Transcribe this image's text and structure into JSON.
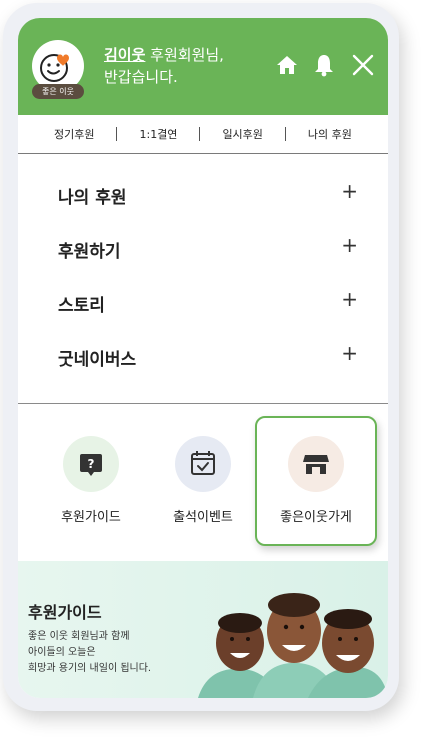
{
  "header": {
    "avatar_badge": "좋은 이웃",
    "user_name": "김이웃",
    "greeting_suffix": " 후원회원님,",
    "greeting_line2": "반갑습니다."
  },
  "tabs": [
    "정기후원",
    "1:1결연",
    "일시후원",
    "나의 후원"
  ],
  "menu": [
    {
      "label": "나의 후원",
      "plus": "+"
    },
    {
      "label": "후원하기",
      "plus": "+"
    },
    {
      "label": "스토리",
      "plus": "+"
    },
    {
      "label": "굿네이버스",
      "plus": "+"
    }
  ],
  "quick_links": [
    {
      "label": "후원가이드",
      "icon": "question-bubble-icon"
    },
    {
      "label": "출석이벤트",
      "icon": "calendar-check-icon"
    },
    {
      "label": "좋은이웃가게",
      "icon": "store-icon"
    }
  ],
  "banner": {
    "title": "후원가이드",
    "line1": "좋은 이웃 회원님과 함께",
    "line2": "아이들의 오늘은",
    "line3": "희망과 용기의 내일이 됩니다."
  },
  "colors": {
    "brand_green": "#6ab457",
    "badge_brown": "#5b4d3f",
    "heart_orange": "#f07a2a"
  }
}
